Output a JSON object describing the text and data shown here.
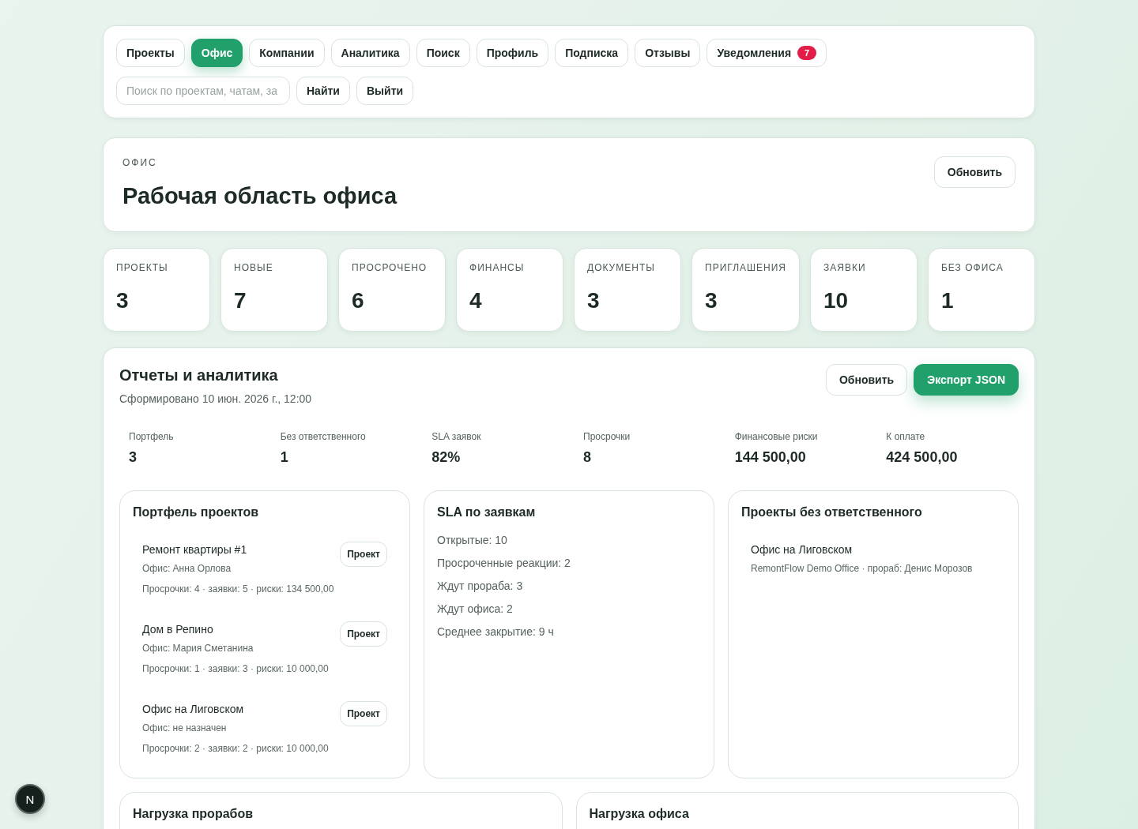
{
  "nav": {
    "tabs": [
      {
        "label": "Проекты",
        "selected": false
      },
      {
        "label": "Офис",
        "selected": true
      },
      {
        "label": "Компании",
        "selected": false
      },
      {
        "label": "Аналитика",
        "selected": false
      },
      {
        "label": "Поиск",
        "selected": false
      },
      {
        "label": "Профиль",
        "selected": false
      },
      {
        "label": "Подписка",
        "selected": false
      },
      {
        "label": "Отзывы",
        "selected": false
      },
      {
        "label": "Уведомления",
        "selected": false,
        "badge": "7"
      }
    ],
    "search": {
      "placeholder": "Поиск по проектам, чатам, за"
    },
    "buttons": [
      "Найти",
      "Выйти"
    ]
  },
  "header": {
    "eyebrow": "ОФИС",
    "title": "Рабочая область офиса",
    "button": "Обновить"
  },
  "stats": [
    {
      "label": "ПРОЕКТЫ",
      "value": "3"
    },
    {
      "label": "НОВЫЕ",
      "value": "7"
    },
    {
      "label": "ПРОСРОЧЕНО",
      "value": "6"
    },
    {
      "label": "ФИНАНСЫ",
      "value": "4"
    },
    {
      "label": "ДОКУМЕНТЫ",
      "value": "3"
    },
    {
      "label": "ПРИГЛАШЕНИЯ",
      "value": "3"
    },
    {
      "label": "ЗАЯВКИ",
      "value": "10"
    },
    {
      "label": "БЕЗ ОФИСА",
      "value": "1"
    }
  ],
  "reports": {
    "title": "Отчеты и аналитика",
    "subtitle": "Сформировано 10 июн. 2026 г., 12:00",
    "buttons": [
      {
        "label": "Обновить",
        "kind": "secondary"
      },
      {
        "label": "Экспорт JSON",
        "kind": "primary"
      }
    ],
    "metrics": [
      {
        "label": "Портфель",
        "value": "3"
      },
      {
        "label": "Без ответственного",
        "value": "1"
      },
      {
        "label": "SLA заявок",
        "value": "82%"
      },
      {
        "label": "Просрочки",
        "value": "8"
      },
      {
        "label": "Финансовые риски",
        "value": "144 500,00"
      },
      {
        "label": "К оплате",
        "value": "424 500,00"
      }
    ],
    "panels": [
      {
        "kind": "projects",
        "title": "Портфель проектов",
        "items": [
          {
            "name": "Ремонт квартиры #1",
            "office": "Офис: Анна Орлова",
            "stats": "Просрочки: 4 · заявки: 5 · риски: 134 500,00",
            "button": "Проект"
          },
          {
            "name": "Дом в Репино",
            "office": "Офис: Мария Сметанина",
            "stats": "Просрочки: 1 · заявки: 3 · риски: 10 000,00",
            "button": "Проект"
          },
          {
            "name": "Офис на Лиговском",
            "office": "Офис: не назначен",
            "stats": "Просрочки: 2 · заявки: 2 · риски: 10 000,00",
            "button": "Проект"
          }
        ]
      },
      {
        "kind": "lines",
        "title": "SLA по заявкам",
        "lines": [
          "Открытые: 10",
          "Просроченные реакции: 2",
          "Ждут прораба: 3",
          "Ждут офиса: 2",
          "Среднее закрытие: 9 ч"
        ]
      },
      {
        "kind": "unassigned",
        "title": "Проекты без ответственного",
        "items": [
          {
            "name": "Офис на Лиговском",
            "details": "RemontFlow Demo Office · прораб: Денис Морозов"
          }
        ]
      }
    ],
    "bottom_panels": [
      {
        "title": "Нагрузка прорабов"
      },
      {
        "title": "Нагрузка офиса"
      }
    ]
  },
  "dev_badge": {
    "label": "N"
  }
}
